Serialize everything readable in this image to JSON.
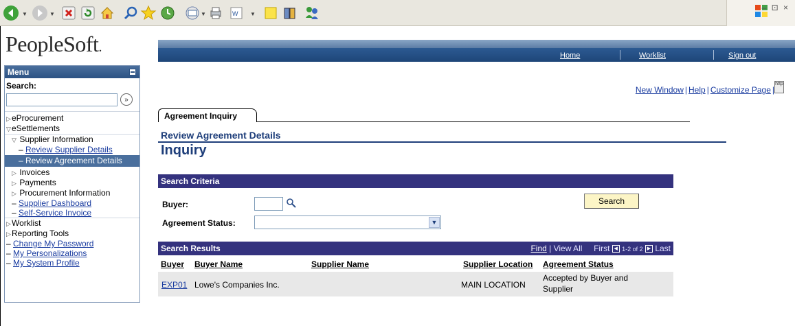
{
  "browser": {
    "toolbar_icons": [
      "back-icon",
      "forward-icon",
      "stop-icon",
      "refresh-icon",
      "home-icon",
      "search-icon",
      "favorites-icon",
      "history-icon",
      "mail-icon",
      "print-icon",
      "word-icon",
      "notes-icon",
      "research-icon",
      "messenger-icon"
    ],
    "window_controls": "– ⊡ ×"
  },
  "header": {
    "logo": "PeopleSoft",
    "nav": {
      "home": "Home",
      "worklist": "Worklist",
      "sign_out": "Sign out"
    }
  },
  "sidebar": {
    "title": "Menu",
    "search_label": "Search:",
    "search_value": "",
    "items": [
      {
        "label": "eProcurement",
        "level": 1,
        "state": "collapsed"
      },
      {
        "label": "eSettlements",
        "level": 1,
        "state": "expanded"
      },
      {
        "label": "Supplier Information",
        "level": 2,
        "state": "expanded"
      },
      {
        "label": "Review Supplier Details",
        "level": 3,
        "type": "link"
      },
      {
        "label": "Review Agreement Details",
        "level": 3,
        "type": "active"
      },
      {
        "label": "Invoices",
        "level": 2,
        "state": "collapsed"
      },
      {
        "label": "Payments",
        "level": 2,
        "state": "collapsed"
      },
      {
        "label": "Procurement Information",
        "level": 2,
        "state": "collapsed"
      },
      {
        "label": "Supplier Dashboard",
        "level": 2,
        "type": "link"
      },
      {
        "label": "Self-Service Invoice",
        "level": 2,
        "type": "link"
      },
      {
        "label": "Worklist",
        "level": 1,
        "state": "collapsed"
      },
      {
        "label": "Reporting Tools",
        "level": 1,
        "state": "collapsed"
      },
      {
        "label": "Change My Password",
        "level": 1,
        "type": "link"
      },
      {
        "label": "My Personalizations",
        "level": 1,
        "type": "link"
      },
      {
        "label": "My System Profile",
        "level": 1,
        "type": "link"
      }
    ]
  },
  "page_links": {
    "new_window": "New Window",
    "help": "Help",
    "customize": "Customize Page",
    "http_icon": "http"
  },
  "tab": {
    "label": "Agreement Inquiry"
  },
  "page": {
    "subtitle": "Review Agreement Details",
    "title": "Inquiry"
  },
  "criteria": {
    "header": "Search Criteria",
    "buyer_label": "Buyer:",
    "buyer_value": "",
    "status_label": "Agreement Status:",
    "status_value": "",
    "search_button": "Search"
  },
  "results": {
    "header": "Search Results",
    "find": "Find",
    "view_all": "View All",
    "first": "First",
    "range": "1-2 of 2",
    "last": "Last",
    "columns": [
      "Buyer",
      "Buyer Name",
      "Supplier Name",
      "Supplier Location",
      "Agreement Status"
    ],
    "rows": [
      {
        "buyer": "EXP01",
        "buyer_name": "Lowe's Companies Inc.",
        "supplier_name": "",
        "supplier_location": "MAIN LOCATION",
        "status_line1": "Accepted by Buyer and",
        "status_line2": "Supplier"
      }
    ]
  }
}
